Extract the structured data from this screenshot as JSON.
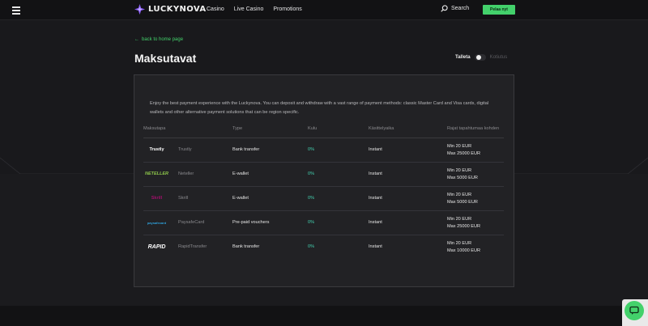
{
  "header": {
    "brand": "LUCKYNOVA",
    "nav": [
      "Casino",
      "Live Casino",
      "Promotions"
    ],
    "search_label": "Search",
    "play_button": "Pelaa nyt"
  },
  "page": {
    "back_link": "back to home page",
    "title": "Maksutavat",
    "toggle_active": "Talleta",
    "toggle_inactive": "Kotiutus",
    "intro": "Enjoy the best payment experience with the Luckynova. You can deposit and withdraw with a vast range of payment methods: classic Master Card and Visa cards, digital wallets and other alternative payment solutions that can be region specific."
  },
  "table": {
    "headers": [
      "Maksutapa",
      "Type",
      "Kulu",
      "Käsittelyaika",
      "Rajat tapahtumaa kohden"
    ],
    "rows": [
      {
        "logo": "Trustly",
        "name": "Trustly",
        "type": "Bank transfer",
        "fee": "0%",
        "time": "Instant",
        "min": "Min 20 EUR",
        "max": "Max 25000 EUR"
      },
      {
        "logo": "NETELLER",
        "name": "Neteller",
        "type": "E-wallet",
        "fee": "0%",
        "time": "Instant",
        "min": "Min 20 EUR",
        "max": "Max 5000 EUR"
      },
      {
        "logo": "Skrill",
        "name": "Skrill",
        "type": "E-wallet",
        "fee": "0%",
        "time": "Instant",
        "min": "Min 20 EUR",
        "max": "Max 5000 EUR"
      },
      {
        "logo": "paysafecard",
        "name": "PaysafeCard",
        "type": "Pre-paid vouchers",
        "fee": "0%",
        "time": "Instant",
        "min": "Min 20 EUR",
        "max": "Max 25000 EUR"
      },
      {
        "logo": "RAPID",
        "name": "RapidTransfer",
        "type": "Bank transfer",
        "fee": "0%",
        "time": "Instant",
        "min": "Min 20 EUR",
        "max": "Max 10000 EUR"
      }
    ]
  },
  "colors": {
    "accent": "#43d16b",
    "fee": "#43d1b0",
    "background": "#1b1b1e",
    "panel": "#222225"
  },
  "icons": [
    "hamburger-menu-icon",
    "star-logo-icon",
    "search-icon",
    "arrow-left-icon",
    "chat-icon"
  ]
}
